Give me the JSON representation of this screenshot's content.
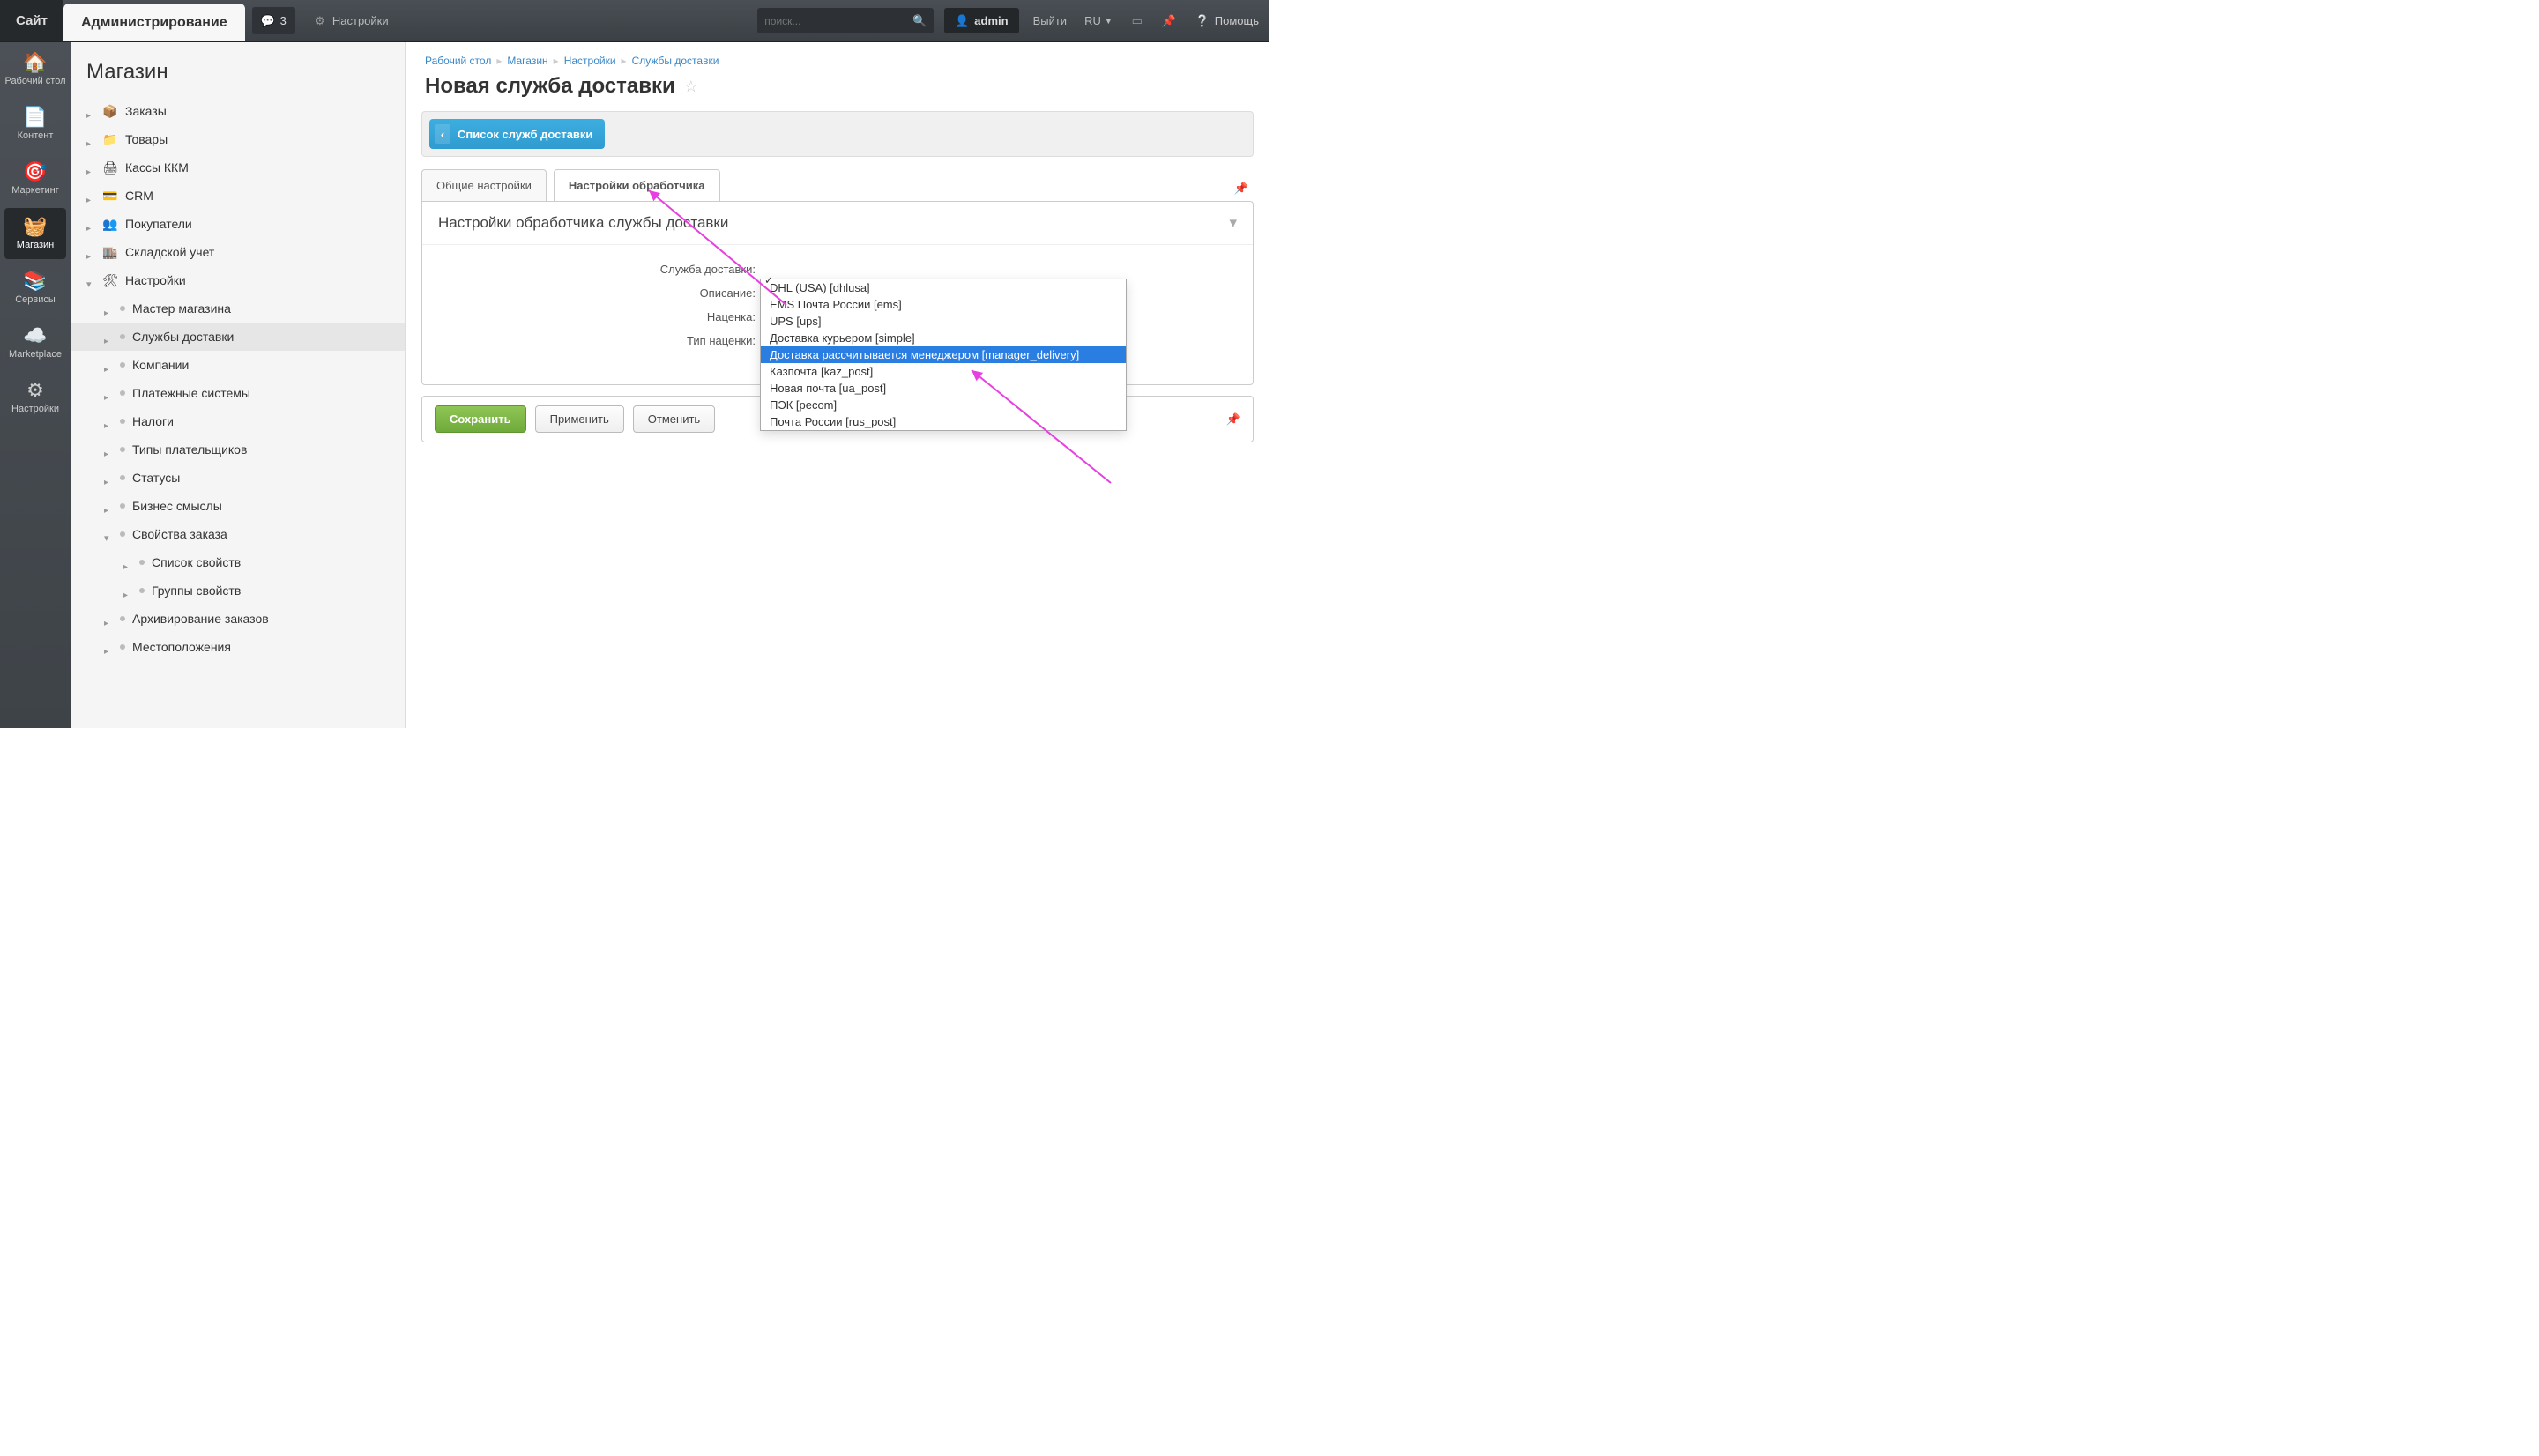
{
  "topbar": {
    "tab_site": "Сайт",
    "tab_admin": "Администрирование",
    "notif_count": "3",
    "settings": "Настройки",
    "search_placeholder": "поиск...",
    "user": "admin",
    "logout": "Выйти",
    "lang": "RU",
    "help": "Помощь"
  },
  "navrail": [
    {
      "label": "Рабочий стол",
      "icon": "🏠"
    },
    {
      "label": "Контент",
      "icon": "📄"
    },
    {
      "label": "Маркетинг",
      "icon": "🎯"
    },
    {
      "label": "Магазин",
      "icon": "🧺",
      "active": true
    },
    {
      "label": "Сервисы",
      "icon": "📚"
    },
    {
      "label": "Marketplace",
      "icon": "☁️"
    },
    {
      "label": "Настройки",
      "icon": "⚙"
    }
  ],
  "sidetree": {
    "title": "Магазин",
    "items": [
      {
        "label": "Заказы",
        "icon": "📦"
      },
      {
        "label": "Товары",
        "icon": "📁"
      },
      {
        "label": "Кассы ККМ",
        "icon": "🖨"
      },
      {
        "label": "CRM",
        "icon": "💳"
      },
      {
        "label": "Покупатели",
        "icon": "👥"
      },
      {
        "label": "Складской учет",
        "icon": "🏬"
      },
      {
        "label": "Настройки",
        "icon": "🛠",
        "expanded": true,
        "children": [
          {
            "label": "Мастер магазина"
          },
          {
            "label": "Службы доставки",
            "active": true
          },
          {
            "label": "Компании"
          },
          {
            "label": "Платежные системы"
          },
          {
            "label": "Налоги"
          },
          {
            "label": "Типы плательщиков"
          },
          {
            "label": "Статусы"
          },
          {
            "label": "Бизнес смыслы"
          },
          {
            "label": "Свойства заказа",
            "expanded": true,
            "children": [
              {
                "label": "Список свойств"
              },
              {
                "label": "Группы свойств"
              }
            ]
          },
          {
            "label": "Архивирование заказов"
          },
          {
            "label": "Местоположения"
          }
        ]
      }
    ]
  },
  "breadcrumbs": [
    {
      "label": "Рабочий стол"
    },
    {
      "label": "Магазин"
    },
    {
      "label": "Настройки"
    },
    {
      "label": "Службы доставки"
    }
  ],
  "page_title": "Новая служба доставки",
  "back_button": "Список служб доставки",
  "tabs": {
    "general": "Общие настройки",
    "handler": "Настройки обработчика"
  },
  "panel": {
    "header": "Настройки обработчика службы доставки",
    "rows": {
      "service": "Служба доставки:",
      "description": "Описание:",
      "markup": "Наценка:",
      "markup_type": "Тип наценки:"
    }
  },
  "buttons": {
    "save": "Сохранить",
    "apply": "Применить",
    "cancel": "Отменить"
  },
  "dropdown": {
    "options": [
      "DHL (USA) [dhlusa]",
      "EMS Почта России [ems]",
      "UPS [ups]",
      "Доставка курьером [simple]",
      "Доставка рассчитывается менеджером [manager_delivery]",
      "Казпочта [kaz_post]",
      "Новая почта [ua_post]",
      "ПЭК [pecom]",
      "Почта России [rus_post]"
    ],
    "selected_index": 4
  }
}
